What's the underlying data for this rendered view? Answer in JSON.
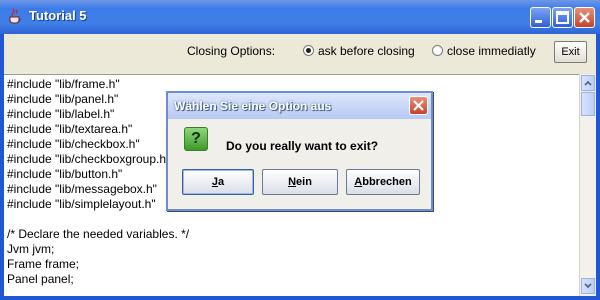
{
  "window": {
    "title": "Tutorial 5",
    "controls": [
      "minimize-icon",
      "maximize-icon",
      "close-icon"
    ]
  },
  "toolbar": {
    "closing_label": "Closing Options:",
    "options": [
      {
        "label": "ask before closing",
        "selected": true
      },
      {
        "label": "close immediatly",
        "selected": false
      }
    ],
    "exit_label": "Exit"
  },
  "code_lines": [
    "#include \"lib/frame.h\"",
    "#include \"lib/panel.h\"",
    "#include \"lib/label.h\"",
    "#include \"lib/textarea.h\"",
    "#include \"lib/checkbox.h\"",
    "#include \"lib/checkboxgroup.h\"",
    "#include \"lib/button.h\"",
    "#include \"lib/messagebox.h\"",
    "#include \"lib/simplelayout.h\"",
    "",
    "/* Declare the needed variables. */",
    "Jvm jvm;",
    "Frame frame;",
    "Panel panel;"
  ],
  "dialog": {
    "title": "Wählen Sie eine Option aus",
    "icon": "question-icon",
    "icon_text": "?",
    "message": "Do you really want to exit?",
    "buttons": [
      {
        "label": "Ja",
        "mnemonic": "J"
      },
      {
        "label": "Nein",
        "mnemonic": "N"
      },
      {
        "label": "Abbrechen",
        "mnemonic": "A"
      }
    ]
  },
  "colors": {
    "titlebar": "#3c7ce8",
    "dialog_border": "#6c8fcf",
    "question_icon": "#3f9a2a"
  }
}
